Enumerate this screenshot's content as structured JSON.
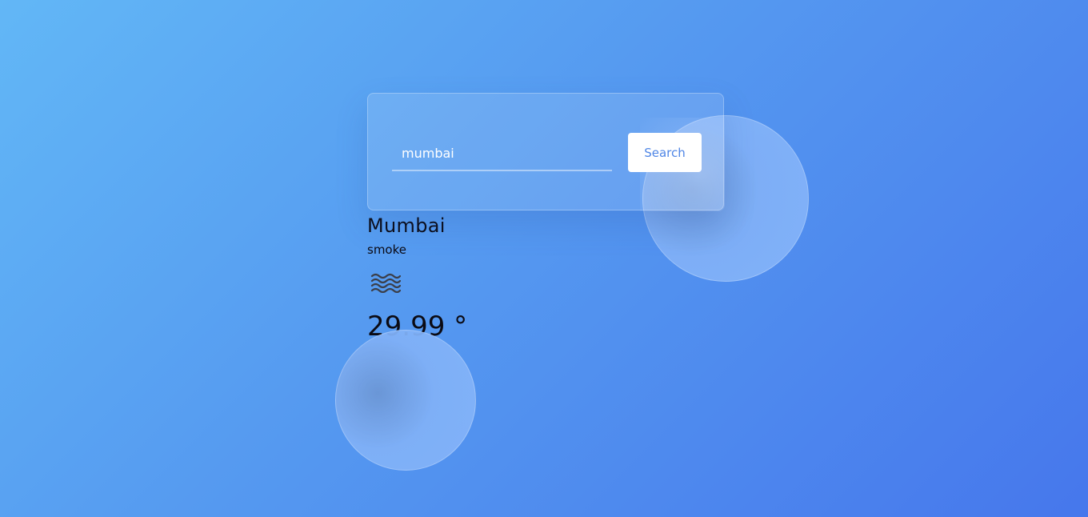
{
  "search": {
    "value": "mumbai",
    "button_label": "Search"
  },
  "weather": {
    "city": "Mumbai",
    "condition": "smoke",
    "icon": "haze-waves-icon",
    "temperature": "29.99 °"
  },
  "colors": {
    "background_start": "#62b7f6",
    "background_end": "#4677ec",
    "button_text": "#4f86e6"
  }
}
